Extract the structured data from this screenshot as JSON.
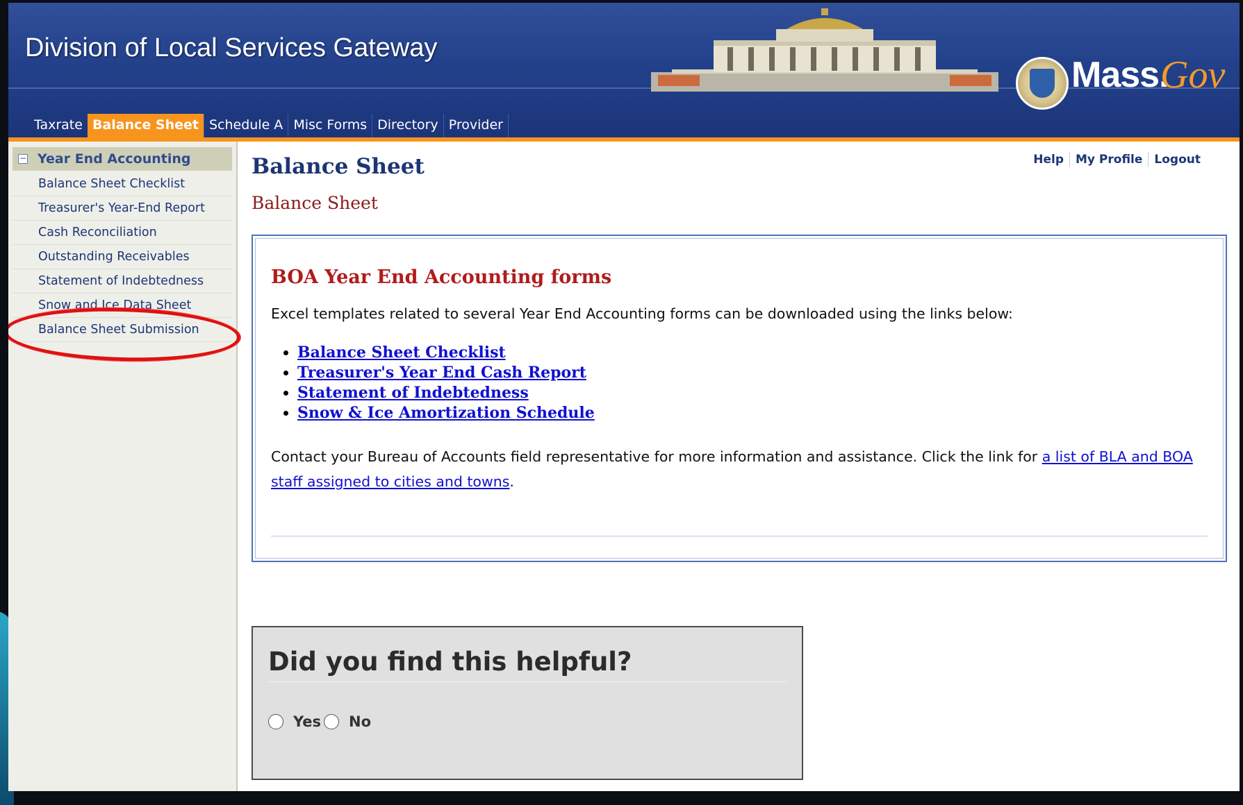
{
  "header": {
    "site_title": "Division of Local Services Gateway",
    "logo_text": "Mass.",
    "logo_gov": "Gov"
  },
  "tabs": [
    {
      "label": "Taxrate",
      "active": false
    },
    {
      "label": "Balance Sheet",
      "active": true
    },
    {
      "label": "Schedule A",
      "active": false
    },
    {
      "label": "Misc Forms",
      "active": false
    },
    {
      "label": "Directory",
      "active": false
    },
    {
      "label": "Provider",
      "active": false
    }
  ],
  "sidebar": {
    "section_label": "Year End Accounting",
    "collapse_glyph": "−",
    "items": [
      {
        "label": "Balance Sheet Checklist"
      },
      {
        "label": "Treasurer's Year-End Report"
      },
      {
        "label": "Cash Reconciliation"
      },
      {
        "label": "Outstanding Receivables"
      },
      {
        "label": "Statement of Indebtedness"
      },
      {
        "label": "Snow and Ice Data Sheet"
      },
      {
        "label": "Balance Sheet Submission"
      }
    ]
  },
  "main": {
    "page_title": "Balance Sheet",
    "sub_title": "Balance Sheet",
    "util_links": {
      "help": "Help",
      "profile": "My Profile",
      "logout": "Logout"
    },
    "box": {
      "heading": "BOA Year End Accounting forms",
      "intro": "Excel templates related to several Year End Accounting forms can be downloaded using the links below:",
      "links": [
        "Balance Sheet Checklist",
        "Treasurer's Year End Cash Report",
        "Statement of Indebtedness",
        "Snow & Ice Amortization Schedule"
      ],
      "contact_prefix": "Contact your Bureau of Accounts field representative for more information and assistance. Click the link for ",
      "contact_link": "a list of BLA and BOA staff assigned to cities and towns",
      "contact_suffix": "."
    },
    "feedback": {
      "title": "Did you find this helpful?",
      "yes": "Yes",
      "no": "No"
    }
  },
  "colors": {
    "header_blue": "#23418a",
    "accent_orange": "#f7941d",
    "link_blue": "#1010d0",
    "heading_red": "#b01c1c",
    "annotation_red": "#e01010"
  }
}
